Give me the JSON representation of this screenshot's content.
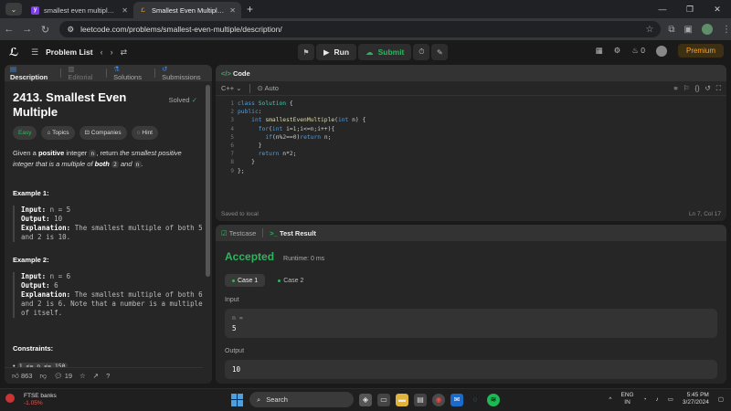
{
  "browser": {
    "tabs": [
      {
        "title": "smallest even multiple leetcode",
        "active": false
      },
      {
        "title": "Smallest Even Multiple - LeetCo",
        "active": true
      }
    ],
    "url": "leetcode.com/problems/smallest-even-multiple/description/"
  },
  "lc": {
    "problem_list": "Problem List",
    "run": "Run",
    "submit": "Submit",
    "streak": "0",
    "premium": "Premium"
  },
  "left": {
    "tabs": [
      "Description",
      "Editorial",
      "Solutions",
      "Submissions"
    ],
    "title": "2413. Smallest Even Multiple",
    "solved": "Solved",
    "chips": [
      "Easy",
      "Topics",
      "Companies",
      "Hint"
    ],
    "desc": {
      "p1": "Given a ",
      "bold": "positive",
      "p2": " integer ",
      "n": "n",
      "p3": ", return ",
      "italic": "the smallest positive integer that is a multiple of ",
      "both": "both",
      "two": "2",
      "and": " and ",
      "n2": "n",
      "dot": "."
    },
    "examples": [
      {
        "heading": "Example 1:",
        "input": "n = 5",
        "output": "10",
        "explanation": "The smallest multiple of both 5 and 2 is 10."
      },
      {
        "heading": "Example 2:",
        "input": "n = 6",
        "output": "6",
        "explanation": "The smallest multiple of both 6 and 2 is 6. Note that a number is a multiple of itself."
      }
    ],
    "labels": {
      "input": "Input:",
      "output": "Output:",
      "explanation": "Explanation:"
    },
    "constraints": "Constraints:",
    "constraint1": "1 <= n <= 150",
    "likes": "863",
    "comments": "19"
  },
  "code": {
    "header": "Code",
    "lang": "C++",
    "mode": "Auto",
    "lines": [
      "1",
      "2",
      "3",
      "4",
      "5",
      "6",
      "7",
      "8",
      "9"
    ],
    "saved": "Saved to local",
    "cursor": "Ln 7, Col 17"
  },
  "result": {
    "tabs": [
      "Testcase",
      "Test Result"
    ],
    "status": "Accepted",
    "runtime": "Runtime: 0 ms",
    "cases": [
      "Case 1",
      "Case 2"
    ],
    "input_label": "Input",
    "input_key": "n =",
    "input_val": "5",
    "output_label": "Output",
    "output_val": "10"
  },
  "taskbar": {
    "stock_name": "FTSE banks",
    "stock_change": "-1.05%",
    "search": "Search",
    "lang": "ENG",
    "region": "IN",
    "time": "5:45 PM",
    "date": "3/27/2024"
  }
}
